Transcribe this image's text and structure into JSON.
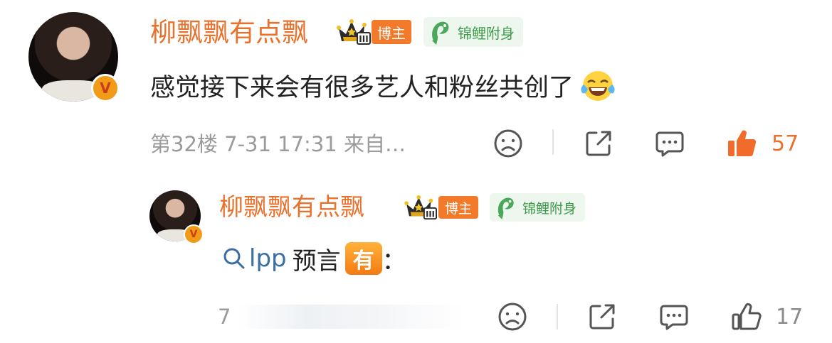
{
  "comments": [
    {
      "username": "柳飘飘有点飘",
      "blogger_badge": "博主",
      "crown_level": "III",
      "koi_badge": "锦鲤附身",
      "content": "感觉接下来会有很多艺人和粉丝共创了",
      "meta": "第32楼 7-31 17:31 来自…",
      "likes": "57",
      "liked": true
    },
    {
      "username": "柳飘飘有点飘",
      "blogger_badge": "博主",
      "crown_level": "III",
      "koi_badge": "锦鲤附身",
      "content_link": "lpp",
      "content_text": "预言",
      "content_tag": "有",
      "content_suffix": "：",
      "meta": "7",
      "likes": "17",
      "liked": false
    }
  ],
  "icons": {
    "verified": "verified-v-icon",
    "crown": "crown-icon",
    "koi": "koi-fish-icon",
    "laugh": "laugh-cry-emoji",
    "dislike": "frown-face-icon",
    "share": "share-icon",
    "comment": "comment-icon",
    "like": "thumbs-up-icon",
    "search": "search-icon"
  },
  "colors": {
    "username": "#e9712c",
    "blogger_tag": "#f37a2a",
    "koi_text": "#3f9a4e",
    "like_active": "#f16b2a",
    "meta": "#9b9b9b"
  }
}
